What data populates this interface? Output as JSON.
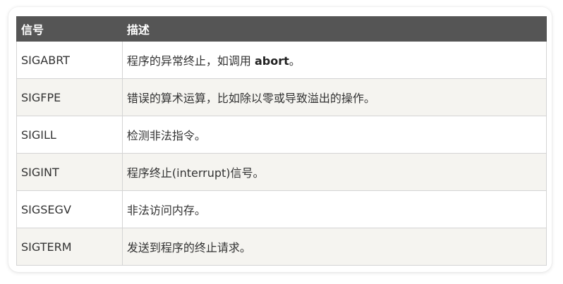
{
  "table": {
    "headers": [
      "信号",
      "描述"
    ],
    "rows": [
      {
        "signal": "SIGABRT",
        "description": "程序的异常终止，如调用 ",
        "description_bold": "abort",
        "description_tail": "。"
      },
      {
        "signal": "SIGFPE",
        "description": "错误的算术运算，比如除以零或导致溢出的操作。"
      },
      {
        "signal": "SIGILL",
        "description": "检测非法指令。"
      },
      {
        "signal": "SIGINT",
        "description": "程序终止(interrupt)信号。"
      },
      {
        "signal": "SIGSEGV",
        "description": "非法访问内存。"
      },
      {
        "signal": "SIGTERM",
        "description": "发送到程序的终止请求。"
      }
    ]
  }
}
